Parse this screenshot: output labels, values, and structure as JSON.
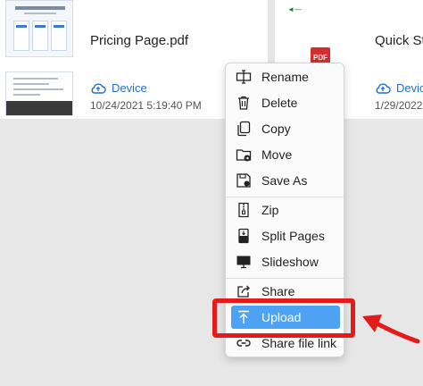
{
  "files": [
    {
      "name": "Pricing Page.pdf",
      "location": "Device",
      "date": "10/24/2021 5:19:40 PM"
    },
    {
      "name": "Quick Sta",
      "location": "Device",
      "date": "1/29/2022"
    }
  ],
  "pdf_badge": "PDF",
  "menu": {
    "items": [
      {
        "label": "Rename",
        "icon": "rename-icon"
      },
      {
        "label": "Delete",
        "icon": "trash-icon"
      },
      {
        "label": "Copy",
        "icon": "copy-icon"
      },
      {
        "label": "Move",
        "icon": "move-icon"
      },
      {
        "label": "Save As",
        "icon": "save-icon"
      },
      {
        "label": "Zip",
        "icon": "zip-icon"
      },
      {
        "label": "Split Pages",
        "icon": "split-icon"
      },
      {
        "label": "Slideshow",
        "icon": "monitor-icon"
      },
      {
        "label": "Share",
        "icon": "share-icon"
      },
      {
        "label": "Upload",
        "icon": "upload-icon",
        "highlighted": true
      },
      {
        "label": "Share file link",
        "icon": "link-icon"
      }
    ]
  },
  "colors": {
    "accent": "#4ea2f3",
    "link": "#1f6fd1",
    "annotation": "#e31b1b",
    "pdf": "#d32f2f"
  }
}
